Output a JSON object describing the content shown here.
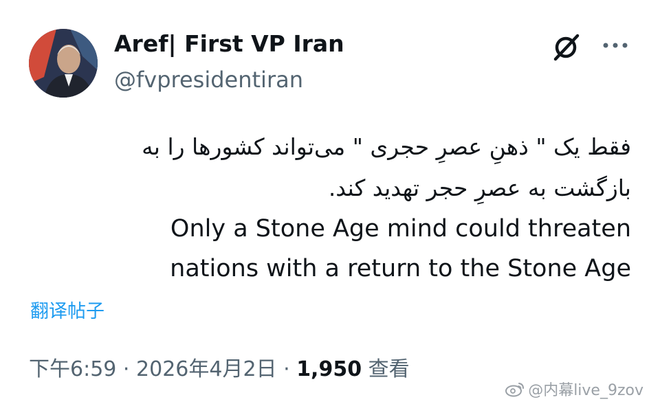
{
  "author": {
    "display_name": "Aref| First VP Iran",
    "handle": "@fvpresidentiran"
  },
  "icons": {
    "grok": "grok-icon",
    "more": "more-options-icon"
  },
  "post": {
    "persian_line_1": "فقط یک \" ذهنِ عصرِ حجری \" می‌تواند کشورها را به",
    "persian_line_2": "بازگشت به عصرِ حجر تهدید کند.",
    "english_line_1": "Only a Stone Age mind could threaten",
    "english_line_2": "nations with a return to the Stone Age"
  },
  "translate_label": "翻译帖子",
  "meta": {
    "time": "下午6:59",
    "separator": "·",
    "date": "2026年4月2日",
    "views_count": "1,950",
    "views_label": "查看"
  },
  "watermark": "@内幕live_9zov",
  "colors": {
    "text": "#0f1419",
    "secondary": "#536471",
    "link": "#1d9bf0"
  }
}
